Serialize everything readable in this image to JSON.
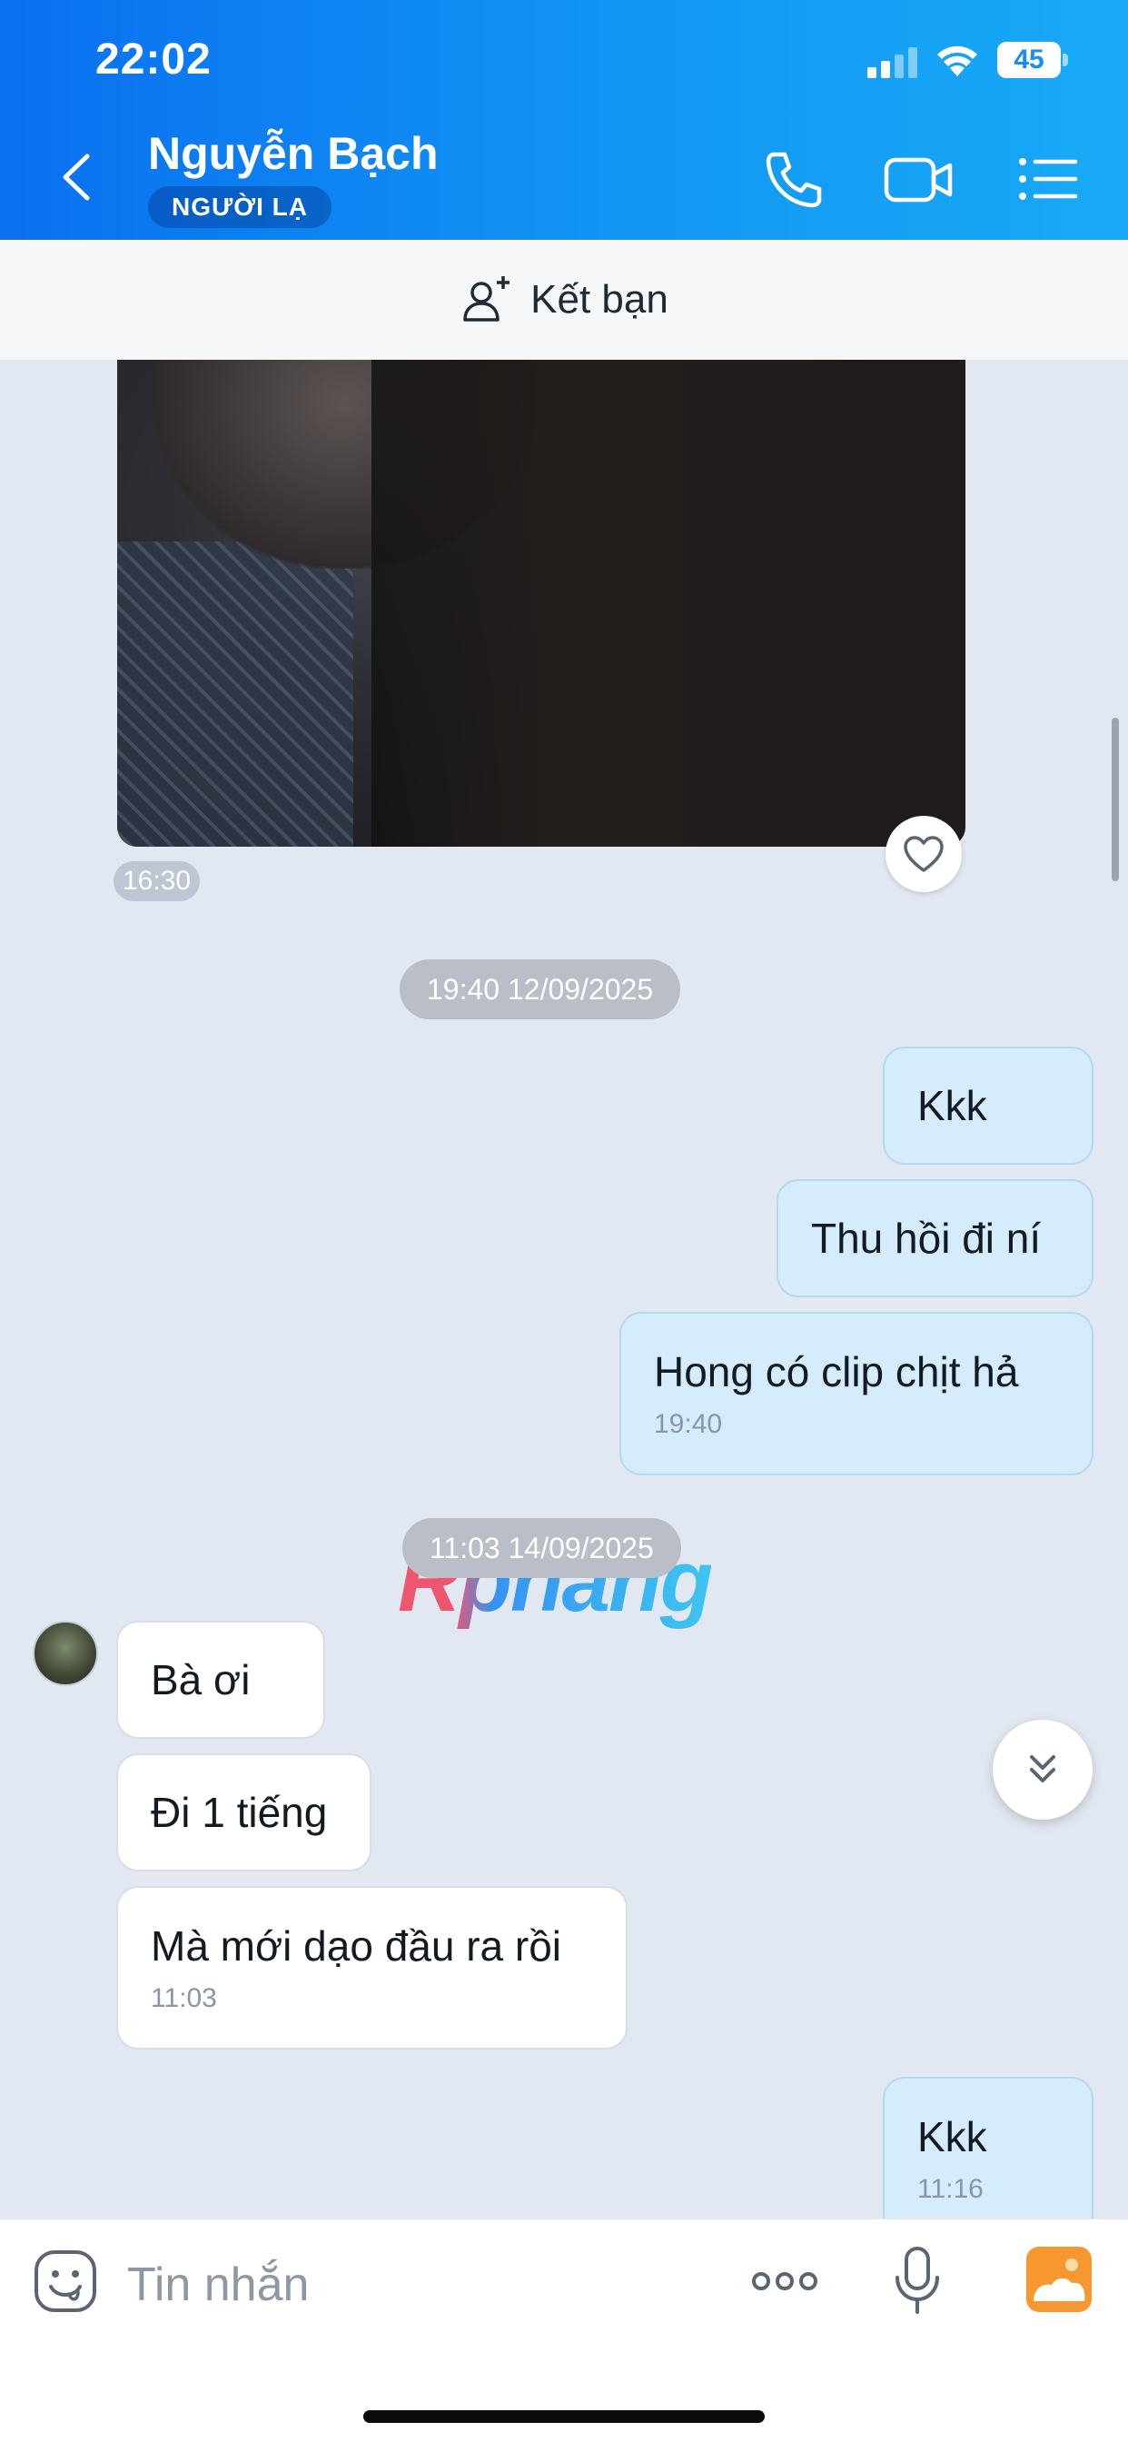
{
  "status_bar": {
    "time": "22:02",
    "battery": "45"
  },
  "header": {
    "contact_name": "Nguyễn Bạch",
    "badge": "NGƯỜI LẠ"
  },
  "friend_bar": {
    "label": "Kết bạn"
  },
  "chat": {
    "photo_time": "16:30",
    "date_1": "19:40 12/09/2025",
    "sent_1": {
      "text": "Kkk"
    },
    "sent_2": {
      "text": "Thu hồi đi ní"
    },
    "sent_3": {
      "text": "Hong có clip chịt hả",
      "time": "19:40"
    },
    "date_2": "11:03 14/09/2025",
    "recv_1": {
      "text": "Bà ơi"
    },
    "recv_2": {
      "text": "Đi 1 tiếng"
    },
    "recv_3": {
      "text": "Mà mới dạo đầu ra rồi",
      "time": "11:03"
    },
    "sent_4": {
      "text": "Kkk",
      "time": "11:16"
    },
    "watermark": "Rphang"
  },
  "input": {
    "placeholder": "Tin nhắn"
  },
  "colors": {
    "header_start": "#0a6ff0",
    "header_end": "#18aaf6",
    "sent_bubble": "#d4ecfb",
    "recv_bubble": "#ffffff",
    "chat_bg": "#e2e8f1"
  }
}
